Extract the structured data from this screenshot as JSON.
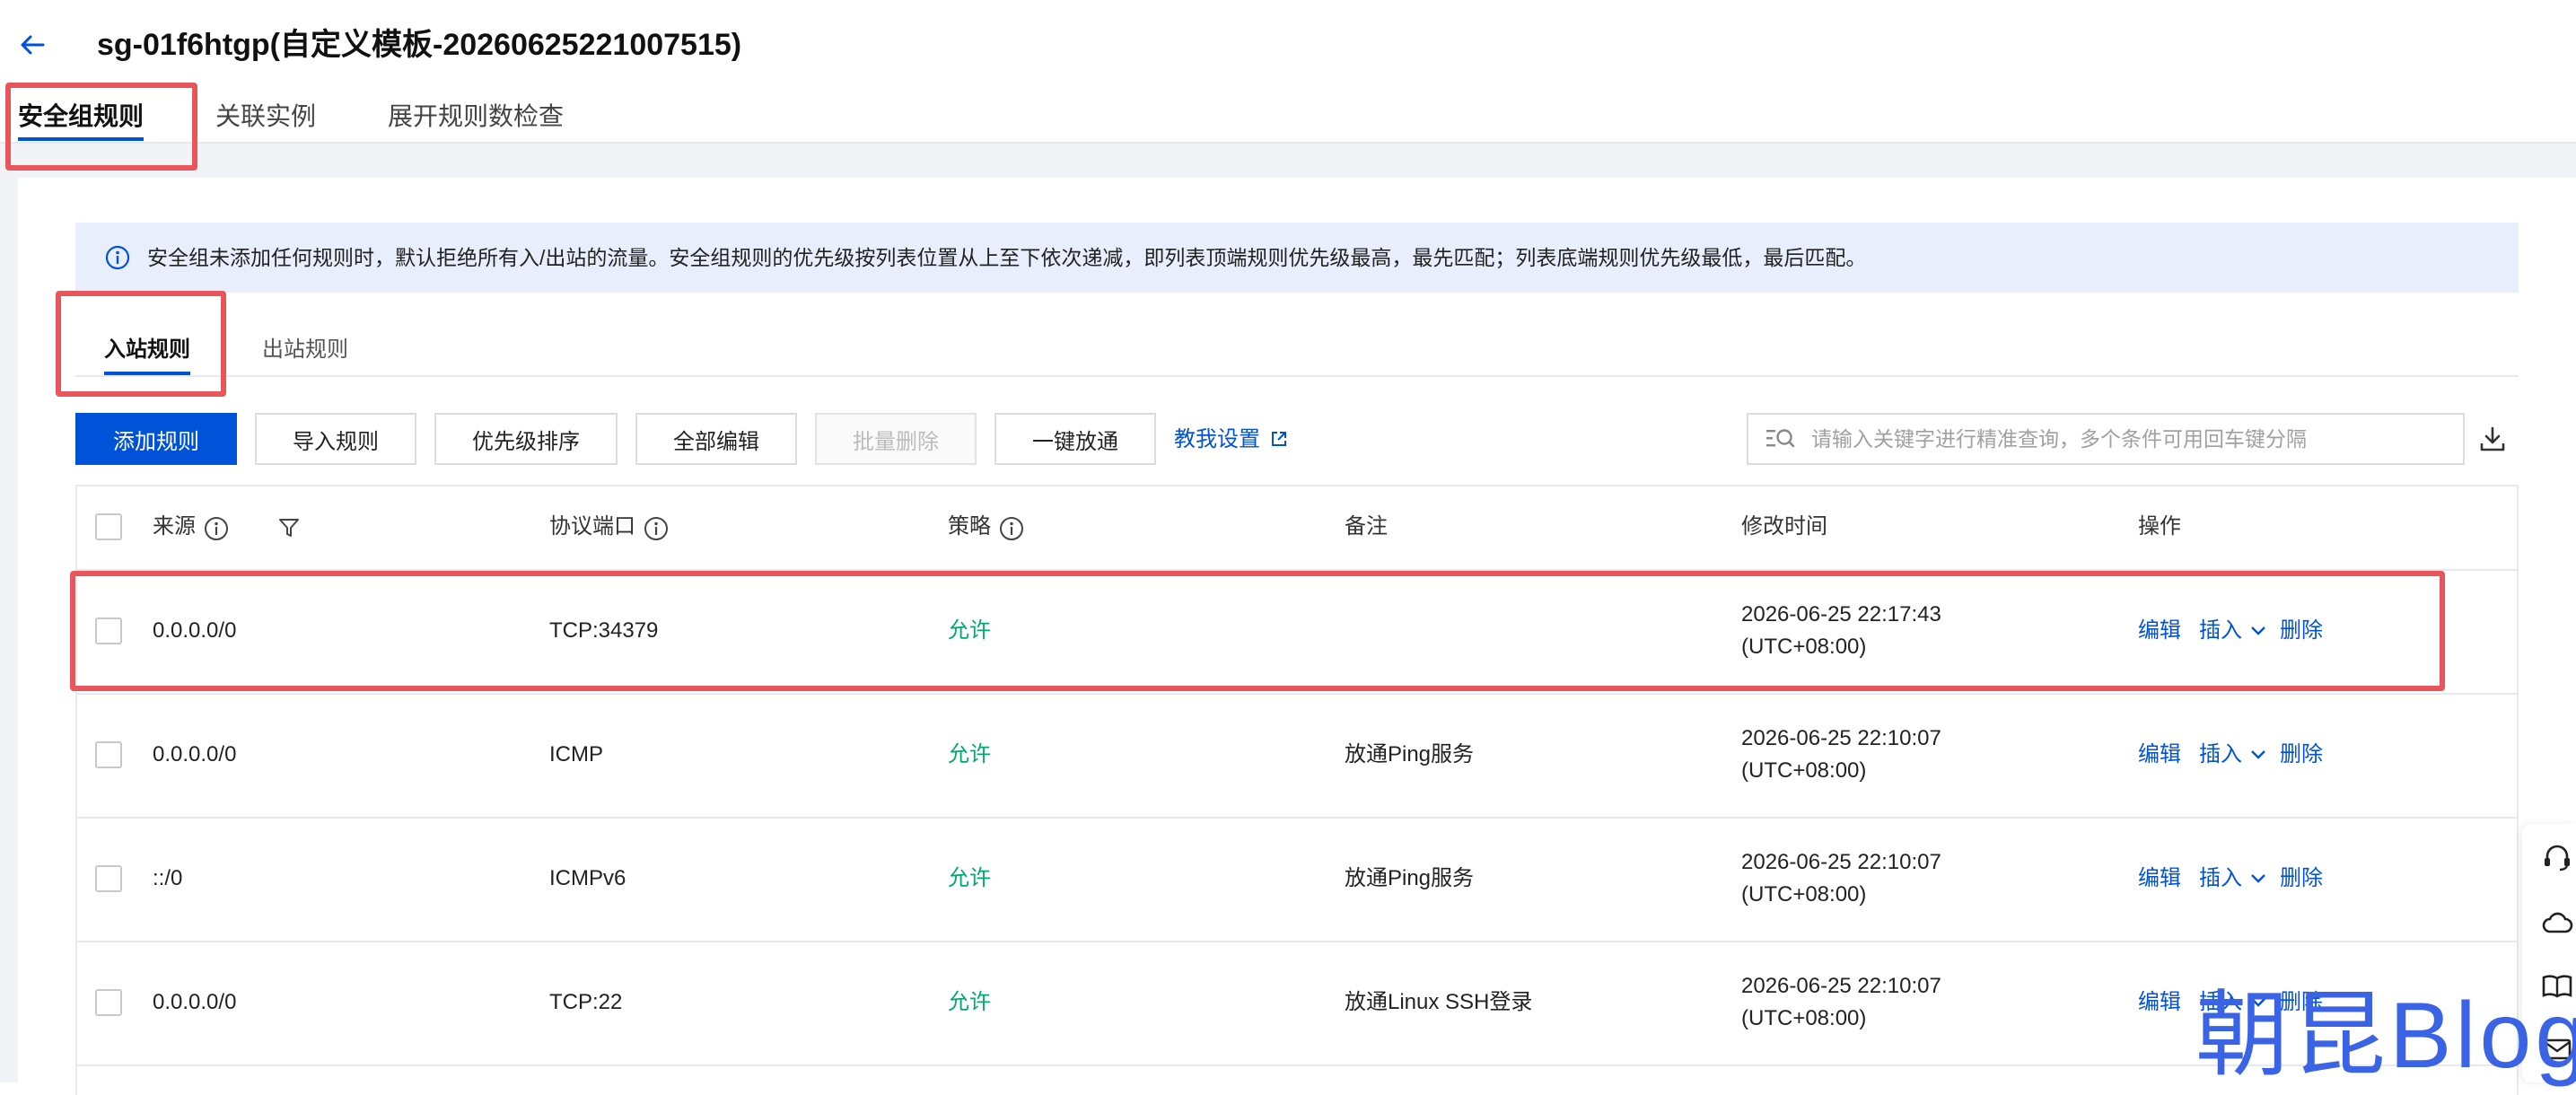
{
  "header": {
    "back_icon": "arrow-left-icon",
    "title": "sg-01f6htgp(自定义模板-20260625221007515)"
  },
  "main_tabs": [
    {
      "label": "安全组规则",
      "active": true
    },
    {
      "label": "关联实例",
      "active": false
    },
    {
      "label": "展开规则数检查",
      "active": false
    }
  ],
  "alert": {
    "icon": "info-circle-icon",
    "text": "安全组未添加任何规则时，默认拒绝所有入/出站的流量。安全组规则的优先级按列表位置从上至下依次递减，即列表顶端规则优先级最高，最先匹配；列表底端规则优先级最低，最后匹配。"
  },
  "sub_tabs": [
    {
      "label": "入站规则",
      "active": true
    },
    {
      "label": "出站规则",
      "active": false
    }
  ],
  "toolbar": {
    "add_rule": "添加规则",
    "import_rule": "导入规则",
    "priority_sort": "优先级排序",
    "edit_all": "全部编辑",
    "batch_delete": "批量删除",
    "one_click_open": "一键放通",
    "help_link": "教我设置",
    "search_placeholder": "请输入关键字进行精准查询，多个条件可用回车键分隔"
  },
  "table": {
    "columns": {
      "source": "来源",
      "protocol_port": "协议端口",
      "policy": "策略",
      "remark": "备注",
      "modified_time": "修改时间",
      "actions": "操作"
    },
    "action_labels": {
      "edit": "编辑",
      "insert": "插入",
      "delete": "删除"
    },
    "rows": [
      {
        "source": "0.0.0.0/0",
        "protocol_port": "TCP:34379",
        "policy": "允许",
        "remark": "",
        "time": "2026-06-25 22:17:43",
        "tz": "(UTC+08:00)"
      },
      {
        "source": "0.0.0.0/0",
        "protocol_port": "ICMP",
        "policy": "允许",
        "remark": "放通Ping服务",
        "time": "2026-06-25 22:10:07",
        "tz": "(UTC+08:00)"
      },
      {
        "source": "::/0",
        "protocol_port": "ICMPv6",
        "policy": "允许",
        "remark": "放通Ping服务",
        "time": "2026-06-25 22:10:07",
        "tz": "(UTC+08:00)"
      },
      {
        "source": "0.0.0.0/0",
        "protocol_port": "TCP:22",
        "policy": "允许",
        "remark": "放通Linux SSH登录",
        "time": "2026-06-25 22:10:07",
        "tz": "(UTC+08:00)"
      }
    ]
  },
  "colors": {
    "primary": "#0052d9",
    "allow": "#00a870",
    "highlight": "#e8555a",
    "alert_bg": "#e8eefc"
  },
  "watermark": "朝昆Blog"
}
